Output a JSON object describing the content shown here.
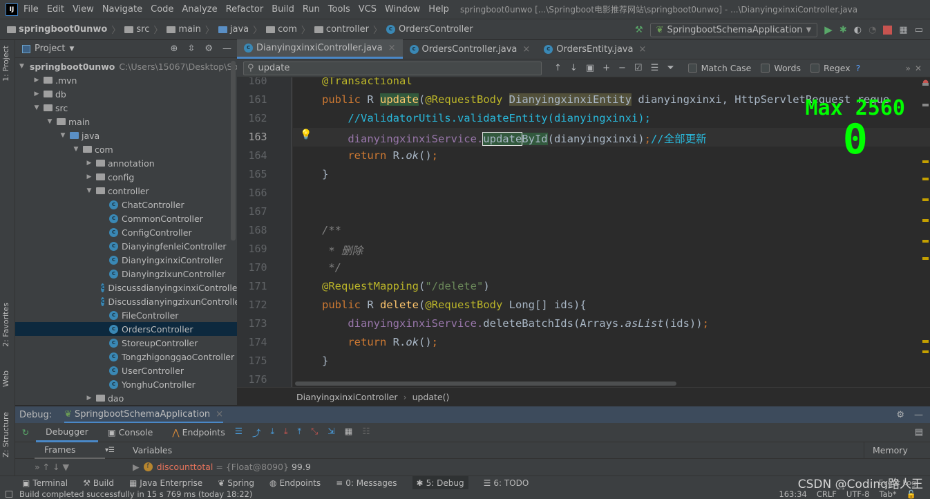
{
  "window": {
    "logo": "IJ",
    "title": "springboot0unwo [...\\Springboot电影推荐网站\\springboot0unwo] - ...\\DianyingxinxiController.java"
  },
  "menu": [
    "File",
    "Edit",
    "View",
    "Navigate",
    "Code",
    "Analyze",
    "Refactor",
    "Build",
    "Run",
    "Tools",
    "VCS",
    "Window",
    "Help"
  ],
  "breadcrumb": [
    "springboot0unwo",
    "src",
    "main",
    "java",
    "com",
    "controller",
    "OrdersController"
  ],
  "run_config": "SpringbootSchemaApplication",
  "left_strip": {
    "project": "1: Project",
    "favorites": "2: Favorites",
    "web": "Web",
    "structure": "Z: Structure"
  },
  "project": {
    "header": "Project",
    "tree": [
      {
        "label": "springboot0unwo",
        "hint": "C:\\Users\\15067\\Desktop\\Sp",
        "level": 0,
        "arrow": "down",
        "icon": "module"
      },
      {
        "label": ".mvn",
        "level": 1,
        "arrow": "right",
        "icon": "folder"
      },
      {
        "label": "db",
        "level": 1,
        "arrow": "right",
        "icon": "folder"
      },
      {
        "label": "src",
        "level": 1,
        "arrow": "down",
        "icon": "folder"
      },
      {
        "label": "main",
        "level": 2,
        "arrow": "down",
        "icon": "folder"
      },
      {
        "label": "java",
        "level": 3,
        "arrow": "down",
        "icon": "folder-blue"
      },
      {
        "label": "com",
        "level": 4,
        "arrow": "down",
        "icon": "package"
      },
      {
        "label": "annotation",
        "level": 5,
        "arrow": "right",
        "icon": "package"
      },
      {
        "label": "config",
        "level": 5,
        "arrow": "right",
        "icon": "package"
      },
      {
        "label": "controller",
        "level": 5,
        "arrow": "down",
        "icon": "package"
      },
      {
        "label": "ChatController",
        "level": 6,
        "icon": "class"
      },
      {
        "label": "CommonController",
        "level": 6,
        "icon": "class"
      },
      {
        "label": "ConfigController",
        "level": 6,
        "icon": "class"
      },
      {
        "label": "DianyingfenleiController",
        "level": 6,
        "icon": "class"
      },
      {
        "label": "DianyingxinxiController",
        "level": 6,
        "icon": "class"
      },
      {
        "label": "DianyingzixunController",
        "level": 6,
        "icon": "class"
      },
      {
        "label": "DiscussdianyingxinxiController",
        "level": 6,
        "icon": "class"
      },
      {
        "label": "DiscussdianyingzixunController",
        "level": 6,
        "icon": "class"
      },
      {
        "label": "FileController",
        "level": 6,
        "icon": "class"
      },
      {
        "label": "OrdersController",
        "level": 6,
        "icon": "class",
        "selected": true
      },
      {
        "label": "StoreupController",
        "level": 6,
        "icon": "class"
      },
      {
        "label": "TongzhigonggaoController",
        "level": 6,
        "icon": "class"
      },
      {
        "label": "UserController",
        "level": 6,
        "icon": "class"
      },
      {
        "label": "YonghuController",
        "level": 6,
        "icon": "class"
      },
      {
        "label": "dao",
        "level": 5,
        "arrow": "right",
        "icon": "package"
      }
    ]
  },
  "tabs": [
    {
      "label": "DianyingxinxiController.java",
      "active": true,
      "close": "×"
    },
    {
      "label": "OrdersController.java",
      "close": "×"
    },
    {
      "label": "OrdersEntity.java",
      "close": "×"
    }
  ],
  "search": {
    "value": "update",
    "options": [
      "Match Case",
      "Words",
      "Regex"
    ],
    "help": "?"
  },
  "code": {
    "current_line": "163",
    "lines": [
      {
        "n": "160",
        "t": [
          [
            "@Transactional",
            "an"
          ]
        ]
      },
      {
        "n": "161",
        "t": [
          [
            "public ",
            "kw"
          ],
          [
            "R ",
            ""
          ],
          [
            "update",
            "mth hl"
          ],
          [
            "(",
            ""
          ],
          [
            "@RequestBody ",
            "an"
          ],
          [
            "DianyingxinxiEntity",
            "hl2"
          ],
          [
            " dianyingxinxi, HttpServletRequest reque",
            ""
          ]
        ]
      },
      {
        "n": "162",
        "t": [
          [
            "    //ValidatorUtils.validateEntity(dianyingxinxi);",
            "lc"
          ]
        ]
      },
      {
        "n": "163",
        "t": [
          [
            "    dianyingxinxiService.",
            "fld"
          ],
          [
            "update",
            "hl box"
          ],
          [
            "ById",
            "hl"
          ],
          [
            "(dianyingxinxi)",
            ""
          ],
          [
            ";",
            "kw"
          ],
          [
            "//全部更新",
            "lc"
          ]
        ]
      },
      {
        "n": "164",
        "t": [
          [
            "    ",
            ""
          ],
          [
            "return ",
            "kw"
          ],
          [
            "R.",
            ""
          ],
          [
            "ok",
            "it"
          ],
          [
            "()",
            ""
          ],
          [
            ";",
            "kw"
          ]
        ]
      },
      {
        "n": "165",
        "t": [
          [
            "}",
            ""
          ]
        ]
      },
      {
        "n": "166",
        "t": []
      },
      {
        "n": "167",
        "t": []
      },
      {
        "n": "168",
        "t": [
          [
            "/**",
            "cm"
          ]
        ]
      },
      {
        "n": "169",
        "t": [
          [
            " * 删除",
            "cm"
          ]
        ]
      },
      {
        "n": "170",
        "t": [
          [
            " */",
            "cm"
          ]
        ]
      },
      {
        "n": "171",
        "t": [
          [
            "@RequestMapping",
            "an"
          ],
          [
            "(",
            ""
          ],
          [
            "\"/delete\"",
            "str"
          ],
          [
            ")",
            ""
          ]
        ]
      },
      {
        "n": "172",
        "t": [
          [
            "public ",
            "kw"
          ],
          [
            "R ",
            ""
          ],
          [
            "delete",
            "mth"
          ],
          [
            "(",
            ""
          ],
          [
            "@RequestBody ",
            "an"
          ],
          [
            "Long[] ids){",
            ""
          ]
        ]
      },
      {
        "n": "173",
        "t": [
          [
            "    dianyingxinxiService.",
            "fld"
          ],
          [
            "deleteBatchIds(Arrays.",
            ""
          ],
          [
            "asList",
            "it"
          ],
          [
            "(ids))",
            ""
          ],
          [
            ";",
            "kw"
          ]
        ]
      },
      {
        "n": "174",
        "t": [
          [
            "    ",
            ""
          ],
          [
            "return ",
            "kw"
          ],
          [
            "R.",
            ""
          ],
          [
            "ok",
            "it"
          ],
          [
            "()",
            ""
          ],
          [
            ";",
            "kw"
          ]
        ]
      },
      {
        "n": "175",
        "t": [
          [
            "}",
            ""
          ]
        ]
      },
      {
        "n": "176",
        "t": []
      }
    ]
  },
  "overlay": {
    "max": "Max 2560",
    "value": "0",
    "color": "#00ff00"
  },
  "editor_breadcrumb": [
    "DianyingxinxiController",
    "update()"
  ],
  "debug": {
    "label": "Debug:",
    "session": "SpringbootSchemaApplication",
    "tabs": [
      "Debugger",
      "Console",
      "Endpoints"
    ],
    "frames": "Frames",
    "variables": "Variables",
    "memory": "Memory",
    "variable": {
      "name": "discounttotal",
      "type": "= {Float@8090}",
      "value": "99.9"
    }
  },
  "bottom_tabs": [
    {
      "label": "Terminal"
    },
    {
      "label": "Build"
    },
    {
      "label": "Java Enterprise"
    },
    {
      "label": "Spring"
    },
    {
      "label": "Endpoints"
    },
    {
      "label": "0: Messages"
    },
    {
      "label": "5: Debug",
      "active": true
    },
    {
      "label": "6: TODO"
    }
  ],
  "event_log": "Event Log",
  "watermark": "CSDN @Coding路人王",
  "status": {
    "message": "Build completed successfully in 15 s 769 ms (today 18:22)",
    "position": "163:34",
    "line_sep": "CRLF",
    "encoding": "UTF-8",
    "indent": "Tab*"
  }
}
